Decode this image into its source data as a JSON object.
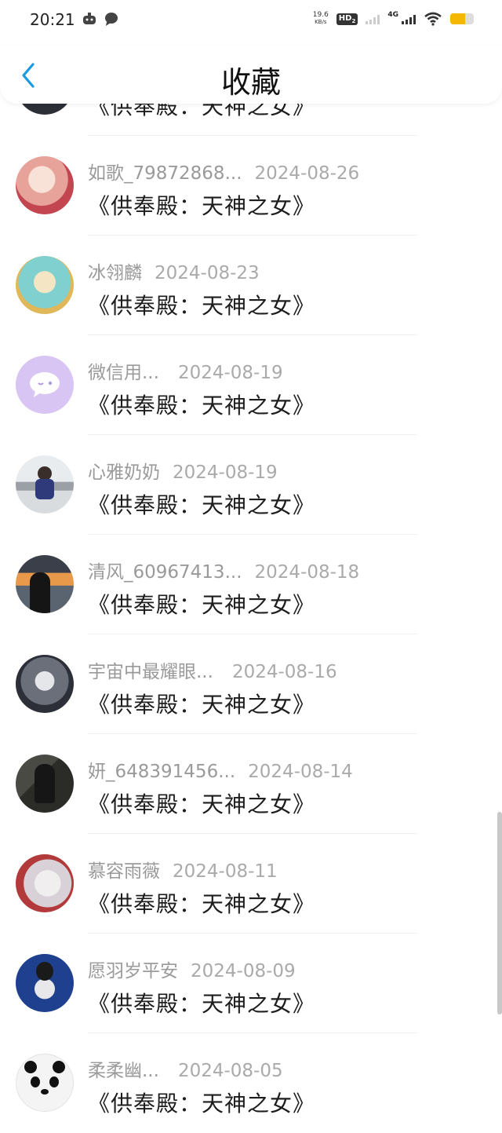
{
  "status_bar": {
    "time": "20:21",
    "net_speed_value": "19.6",
    "net_speed_unit": "KB/s",
    "hd_label": "HD",
    "hd_sub": "2",
    "network_label": "4G",
    "battery_level": 0.64,
    "battery_color": "#f5b700"
  },
  "header": {
    "title": "收藏",
    "back_icon": "chevron-left-icon",
    "accent_color": "#1a9be0"
  },
  "items": [
    {
      "username": "",
      "date": "",
      "book": "《供奉殿：天神之女》"
    },
    {
      "username": "如歌_79872868...",
      "date": "2024-08-26",
      "book": "《供奉殿：天神之女》"
    },
    {
      "username": "冰翎麟",
      "date": "2024-08-23",
      "book": "《供奉殿：天神之女》"
    },
    {
      "username": "微信用...",
      "date": "2024-08-19",
      "book": "《供奉殿：天神之女》"
    },
    {
      "username": "心雅奶奶",
      "date": "2024-08-19",
      "book": "《供奉殿：天神之女》"
    },
    {
      "username": "清风_60967413...",
      "date": "2024-08-18",
      "book": "《供奉殿：天神之女》"
    },
    {
      "username": "宇宙中最耀眼...",
      "date": "2024-08-16",
      "book": "《供奉殿：天神之女》"
    },
    {
      "username": "妍_648391456...",
      "date": "2024-08-14",
      "book": "《供奉殿：天神之女》"
    },
    {
      "username": "慕容雨薇",
      "date": "2024-08-11",
      "book": "《供奉殿：天神之女》"
    },
    {
      "username": "愿羽岁平安",
      "date": "2024-08-09",
      "book": "《供奉殿：天神之女》"
    },
    {
      "username": "柔柔幽...",
      "date": "2024-08-05",
      "book": "《供奉殿：天神之女》"
    }
  ]
}
